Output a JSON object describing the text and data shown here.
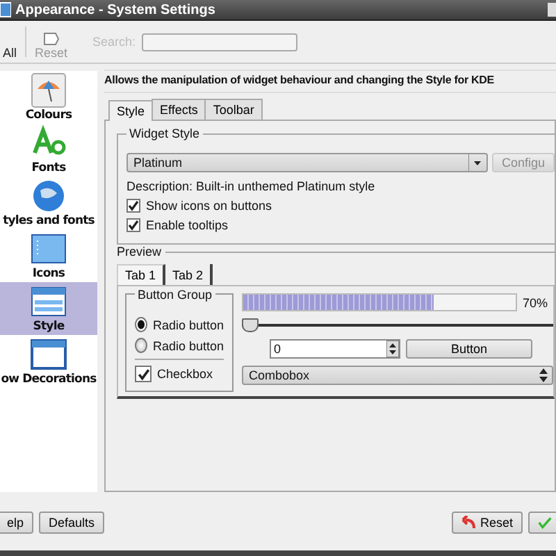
{
  "window": {
    "title": "Appearance - System Settings"
  },
  "toolbar": {
    "items": [
      {
        "label": "All",
        "disabled": false
      },
      {
        "label": "Reset",
        "disabled": true
      }
    ],
    "search": {
      "label": "Search:"
    }
  },
  "sidebar": {
    "items": [
      {
        "label": "Colours",
        "kind": "colours",
        "selected": false
      },
      {
        "label": "Fonts",
        "kind": "fonts",
        "selected": false
      },
      {
        "label": "tyles and fonts",
        "kind": "globe",
        "selected": false
      },
      {
        "label": "Icons",
        "kind": "icons",
        "selected": false
      },
      {
        "label": "Style",
        "kind": "style",
        "selected": true
      },
      {
        "label": "ow Decorations",
        "kind": "window",
        "selected": false
      }
    ]
  },
  "heading": "Allows the manipulation of widget behaviour and changing the Style for KDE",
  "tabs": [
    {
      "label": "Style",
      "selected": true
    },
    {
      "label": "Effects",
      "selected": false
    },
    {
      "label": "Toolbar",
      "selected": false
    }
  ],
  "widget_style": {
    "title": "Widget Style",
    "combobox": "Platinum",
    "configure": {
      "label": "Configu",
      "disabled": true
    },
    "description": "Description: Built-in unthemed Platinum style",
    "options": [
      {
        "label": "Show icons on buttons",
        "checked": true
      },
      {
        "label": "Enable tooltips",
        "checked": true
      }
    ]
  },
  "preview": {
    "title": "Preview",
    "tabs": [
      {
        "label": "Tab 1",
        "selected": true
      },
      {
        "label": "Tab 2",
        "selected": false
      }
    ],
    "button_group": {
      "title": "Button Group",
      "radios": [
        {
          "label": "Radio button",
          "selected": true
        },
        {
          "label": "Radio button",
          "selected": false
        }
      ],
      "checkbox": {
        "label": "Checkbox",
        "checked": true
      }
    },
    "progress": {
      "level": 0.7,
      "reading": "70%"
    },
    "slider": {
      "level": 0
    },
    "spinbox": "0",
    "button": "Button",
    "combobox": "Combobox"
  },
  "footer": {
    "left": [
      "elp",
      "Defaults"
    ],
    "reset": "Reset"
  }
}
